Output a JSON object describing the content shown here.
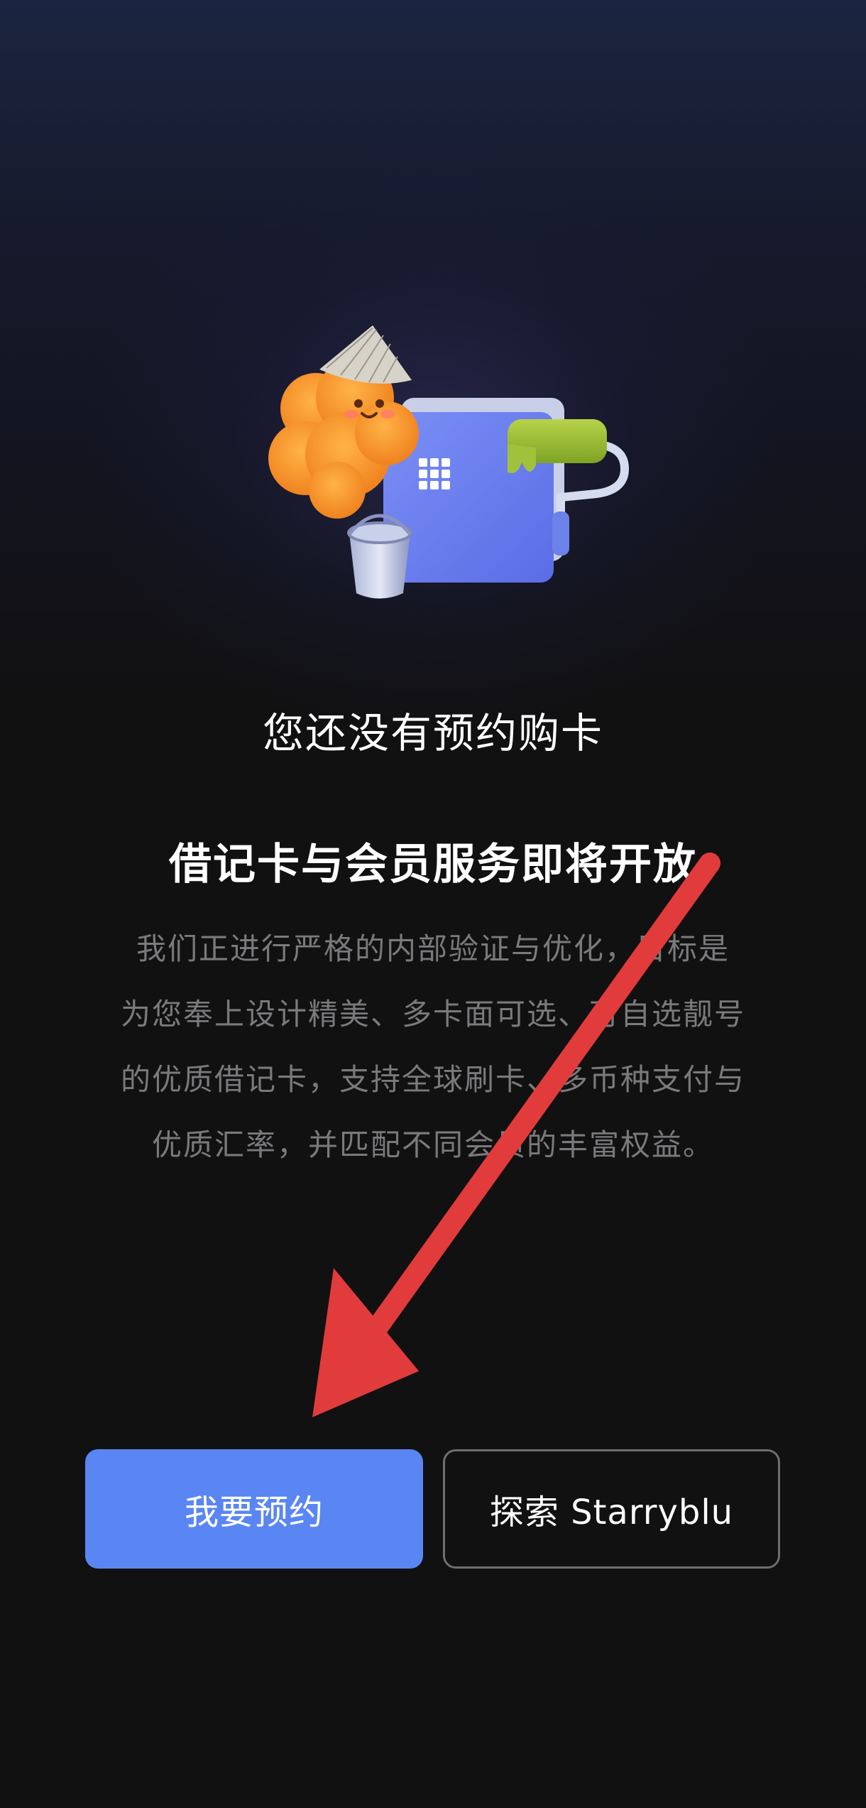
{
  "empty_state": {
    "title": "您还没有预约购卡",
    "subtitle": "借记卡与会员服务即将开放",
    "description_lines": [
      "我们正进行严格的内部验证与优化，目标是",
      "为您奉上设计精美、多卡面可选、可自选靓号",
      "的优质借记卡，支持全球刷卡、多币种支付与",
      "优质汇率，并匹配不同会员的丰富权益。"
    ]
  },
  "actions": {
    "reserve_label": "我要预约",
    "explore_label": "探索 Starryblu"
  },
  "colors": {
    "primary": "#5a86f3",
    "background": "#111112",
    "annotation_arrow": "#e23b3b"
  },
  "icons": {
    "illustration": "card-mascot-paint-illustration",
    "annotation": "red-arrow-annotation"
  }
}
